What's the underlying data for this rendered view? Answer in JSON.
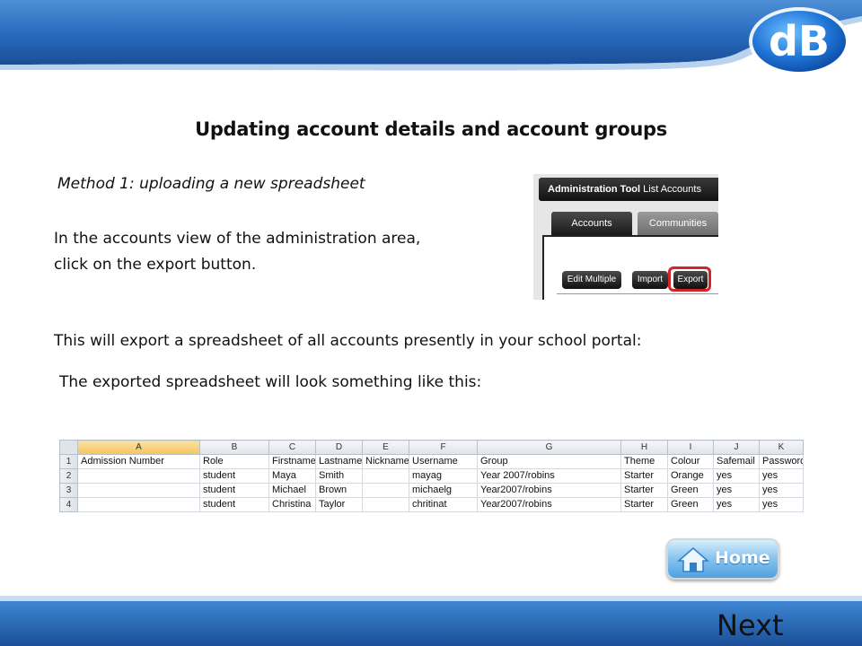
{
  "logo": {
    "text": "dB"
  },
  "title": "Updating account details and account groups",
  "method": "Method 1: uploading a new spreadsheet",
  "instructions": {
    "line1": "In the accounts view of the administration area,",
    "line2": "click on the export button."
  },
  "export_note": "This will export a spreadsheet of all accounts presently in your school portal:",
  "sheet_note": "The exported spreadsheet will look something like this:",
  "admin_tool": {
    "title_bold": "Administration Tool",
    "title_rest": "List Accounts",
    "tabs": [
      "Accounts",
      "Communities"
    ],
    "buttons": {
      "edit_multiple": "Edit Multiple",
      "import": "Import",
      "export": "Export"
    }
  },
  "spreadsheet": {
    "col_letters": [
      "A",
      "B",
      "C",
      "D",
      "E",
      "F",
      "G",
      "H",
      "I",
      "J",
      "K"
    ],
    "row_numbers": [
      "1",
      "2",
      "3",
      "4"
    ],
    "headers": [
      "Admission Number",
      "Role",
      "Firstname",
      "Lastname",
      "Nickname",
      "Username",
      "Group",
      "Theme",
      "Colour",
      "Safemail",
      "PasswordI"
    ],
    "rows": [
      [
        "",
        "student",
        "Maya",
        "Smith",
        "",
        "mayag",
        "Year 2007/robins",
        "Starter",
        "Orange",
        "yes",
        "yes"
      ],
      [
        "",
        "student",
        "Michael",
        "Brown",
        "",
        "michaelg",
        "Year2007/robins",
        "Starter",
        "Green",
        "yes",
        "yes"
      ],
      [
        "",
        "student",
        "Christina",
        "Taylor",
        "",
        "chritinat",
        "Year2007/robins",
        "Starter",
        "Green",
        "yes",
        "yes"
      ]
    ]
  },
  "nav": {
    "home": "Home",
    "next": "Next"
  },
  "colors": {
    "banner_blue": "#1f5fb0",
    "export_ring": "#d3242a",
    "home_button": "#4fa1e0"
  },
  "icons": {
    "home": "house-icon"
  }
}
